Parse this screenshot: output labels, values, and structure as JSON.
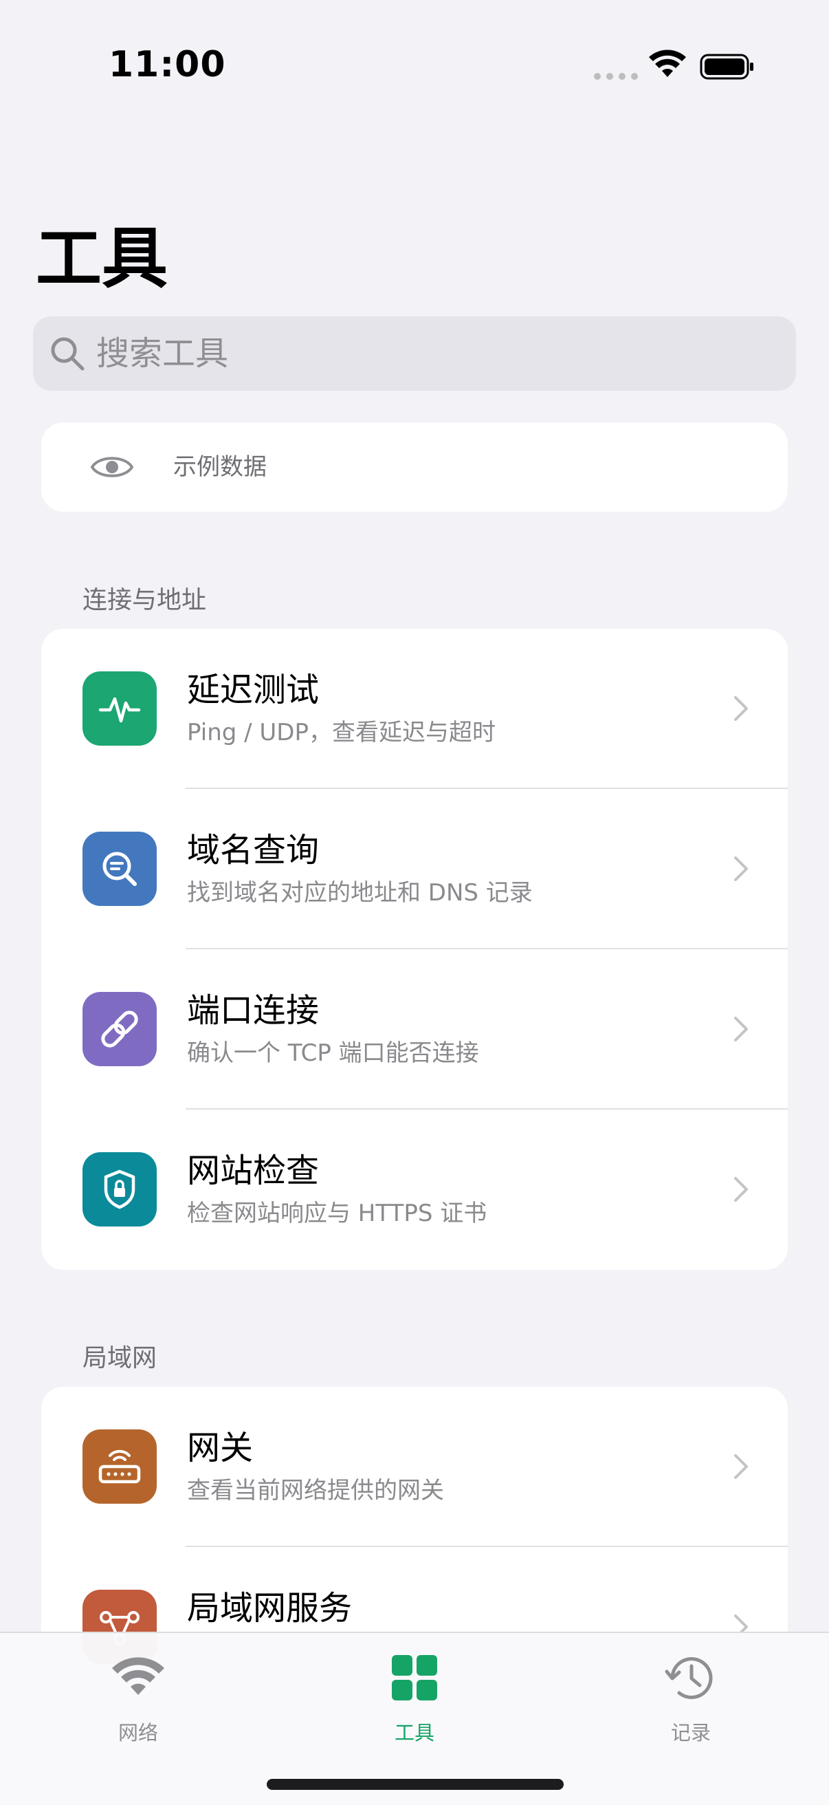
{
  "status_bar": {
    "time": "11:00"
  },
  "page": {
    "title": "工具"
  },
  "search": {
    "placeholder": "搜索工具",
    "value": ""
  },
  "sample": {
    "label": "示例数据",
    "icon": "eye-icon"
  },
  "sections": [
    {
      "header": "连接与地址",
      "items": [
        {
          "title": "延迟测试",
          "subtitle": "Ping / UDP，查看延迟与超时",
          "icon": "pulse-icon",
          "color": "#1BA672"
        },
        {
          "title": "域名查询",
          "subtitle": "找到域名对应的地址和 DNS 记录",
          "icon": "search-doc-icon",
          "color": "#4378BE"
        },
        {
          "title": "端口连接",
          "subtitle": "确认一个 TCP 端口能否连接",
          "icon": "link-icon",
          "color": "#7F6CC2"
        },
        {
          "title": "网站检查",
          "subtitle": "检查网站响应与 HTTPS 证书",
          "icon": "lock-shield-icon",
          "color": "#0B8A9A"
        }
      ]
    },
    {
      "header": "局域网",
      "items": [
        {
          "title": "网关",
          "subtitle": "查看当前网络提供的网关",
          "icon": "router-icon",
          "color": "#B5652B"
        },
        {
          "title": "局域网服务",
          "subtitle": "",
          "icon": "network-icon",
          "color": "#C25A3C"
        }
      ]
    }
  ],
  "tabs": [
    {
      "label": "网络",
      "icon": "wifi-icon",
      "active": false
    },
    {
      "label": "工具",
      "icon": "grid-icon",
      "active": true
    },
    {
      "label": "记录",
      "icon": "history-icon",
      "active": false
    }
  ],
  "colors": {
    "accent": "#16A466",
    "background": "#F2F2F7"
  }
}
